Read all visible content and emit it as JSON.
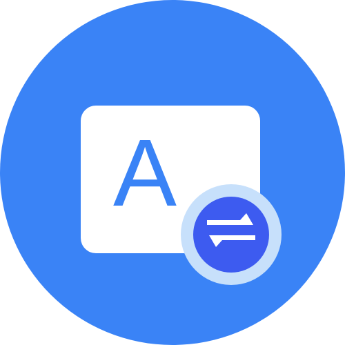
{
  "app_icon": {
    "name": "translate-app-icon",
    "card_letter": "A",
    "badge_icon": "swap-arrows-icon"
  },
  "colors": {
    "background_circle": "#3A83F6",
    "card": "#FFFFFF",
    "letter": "#3A83F6",
    "badge_ring": "#C7E0FB",
    "badge_fill": "#3D5BF0",
    "badge_arrows": "#FFFFFF"
  }
}
